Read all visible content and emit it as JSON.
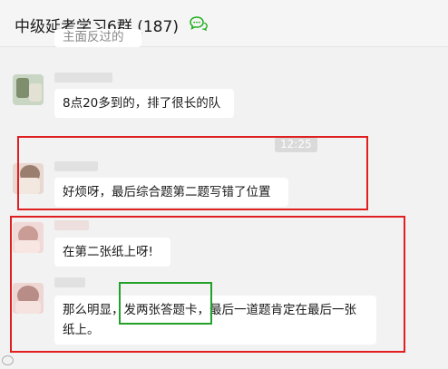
{
  "header": {
    "group_name": "中级延考学习6群",
    "member_count": "(187)",
    "chat_icon": "chat-bubbles-icon"
  },
  "messages": [
    {
      "text": "主面反过的顺"
    },
    {
      "text": "8点20多到的，排了很长的队"
    },
    {
      "time": "12:25",
      "text": "好烦呀，最后综合题第二题写错了位置"
    },
    {
      "text": "在第二张纸上呀!"
    },
    {
      "text_before": "那么明显，",
      "highlight": "发两张答题卡",
      "text_after": "，最后一道题肯定在最后一张",
      "text_line2": "纸上。"
    }
  ],
  "watermark": "",
  "colors": {
    "highlight_red": "#e02020",
    "highlight_green": "#22a12a",
    "background": "#f2f2f2",
    "bubble": "#ffffff"
  }
}
